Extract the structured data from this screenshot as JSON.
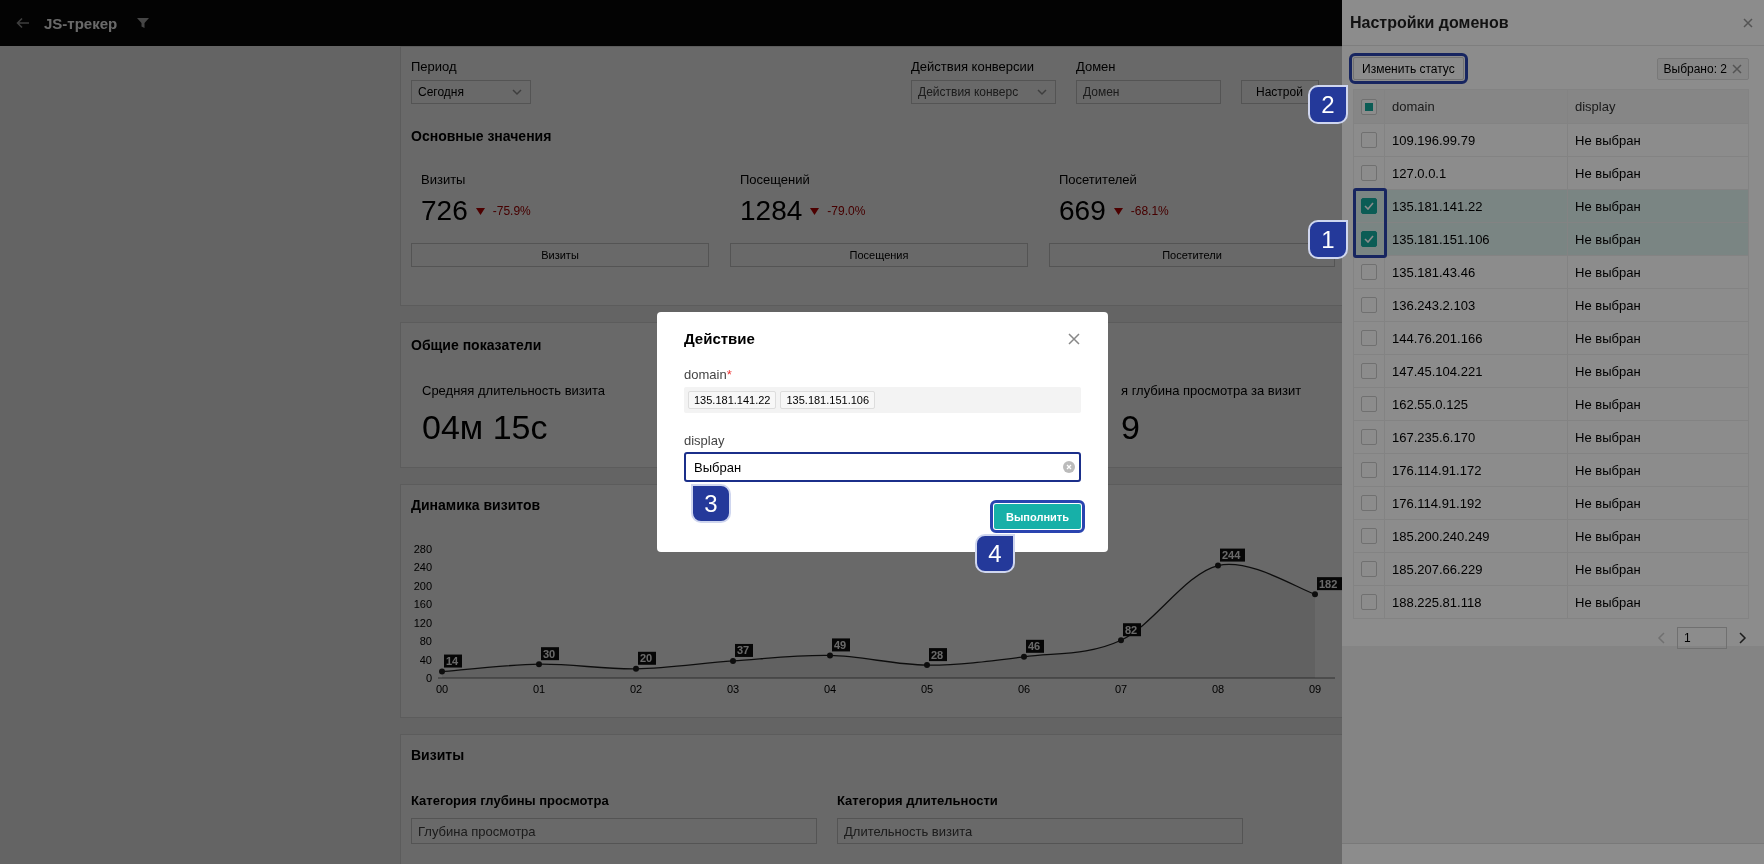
{
  "app_bar": {
    "title": "JS-трекер"
  },
  "filters": [
    {
      "kind": "select",
      "label": "Период",
      "value": "Сегодня"
    },
    {
      "kind": "select",
      "label": "Действия конверсии",
      "placeholder": "Действия конверс"
    },
    {
      "kind": "input",
      "label": "Домен",
      "placeholder": "Домен"
    }
  ],
  "settings_button": "Настрой",
  "main_values": {
    "title": "Основные значения",
    "stats": [
      {
        "label": "Визиты",
        "value": "726",
        "change": "-75.9%",
        "button": "Визиты"
      },
      {
        "label": "Посещений",
        "value": "1284",
        "change": "-79.0%",
        "button": "Посещения"
      },
      {
        "label": "Посетителей",
        "value": "669",
        "change": "-68.1%",
        "button": "Посетители"
      }
    ]
  },
  "general": {
    "title": "Общие показатели",
    "stats": [
      {
        "label": "Средняя длительность визита",
        "value": "04м 15с"
      },
      {
        "label": "я глубина просмотра за визит",
        "value": "9"
      }
    ]
  },
  "dynamics": {
    "title": "Динамика визитов",
    "chart_data": {
      "type": "area",
      "categories": [
        "00",
        "01",
        "02",
        "03",
        "04",
        "05",
        "06",
        "07",
        "08",
        "09"
      ],
      "series": [
        {
          "color": "#222222",
          "marker": true,
          "values": [
            14,
            30,
            20,
            37,
            49,
            28,
            46,
            82,
            244,
            182
          ]
        }
      ],
      "ylim": [
        0,
        280
      ],
      "yticks": [
        0,
        40,
        80,
        120,
        160,
        200,
        240,
        280
      ],
      "data_labels": true
    }
  },
  "visits": {
    "title": "Визиты",
    "fields": [
      {
        "label": "Категория глубины просмотра",
        "placeholder": "Глубина просмотра"
      },
      {
        "label": "Категория длительности",
        "placeholder": "Длительность визита"
      }
    ]
  },
  "drawer": {
    "title": "Настройки доменов",
    "change_status_button": "Изменить статус",
    "selected_tag": "Выбрано: 2",
    "table": {
      "header_checkbox": {
        "indeterminate": true
      },
      "columns": [
        "domain",
        "display"
      ],
      "rows": [
        {
          "domain": "109.196.99.79",
          "display": "Не выбран",
          "selected": false
        },
        {
          "domain": "127.0.0.1",
          "display": "Не выбран",
          "selected": false
        },
        {
          "domain": "135.181.141.22",
          "display": "Не выбран",
          "selected": true
        },
        {
          "domain": "135.181.151.106",
          "display": "Не выбран",
          "selected": true
        },
        {
          "domain": "135.181.43.46",
          "display": "Не выбран",
          "selected": false
        },
        {
          "domain": "136.243.2.103",
          "display": "Не выбран",
          "selected": false
        },
        {
          "domain": "144.76.201.166",
          "display": "Не выбран",
          "selected": false
        },
        {
          "domain": "147.45.104.221",
          "display": "Не выбран",
          "selected": false
        },
        {
          "domain": "162.55.0.125",
          "display": "Не выбран",
          "selected": false
        },
        {
          "domain": "167.235.6.170",
          "display": "Не выбран",
          "selected": false
        },
        {
          "domain": "176.114.91.172",
          "display": "Не выбран",
          "selected": false
        },
        {
          "domain": "176.114.91.192",
          "display": "Не выбран",
          "selected": false
        },
        {
          "domain": "185.200.240.249",
          "display": "Не выбран",
          "selected": false
        },
        {
          "domain": "185.207.66.229",
          "display": "Не выбран",
          "selected": false
        },
        {
          "domain": "188.225.81.118",
          "display": "Не выбран",
          "selected": false
        }
      ]
    },
    "pagination": {
      "page": "1",
      "prev_disabled": true,
      "next_disabled": false
    }
  },
  "modal": {
    "title": "Действие",
    "domain_label": "domain",
    "required_mark": "*",
    "domain_tags": [
      "135.181.141.22",
      "135.181.151.106"
    ],
    "display_label": "display",
    "display_value": "Выбран",
    "submit_button": "Выполнить"
  },
  "annotations": [
    {
      "number": "1"
    },
    {
      "number": "2"
    },
    {
      "number": "3"
    },
    {
      "number": "4"
    }
  ]
}
